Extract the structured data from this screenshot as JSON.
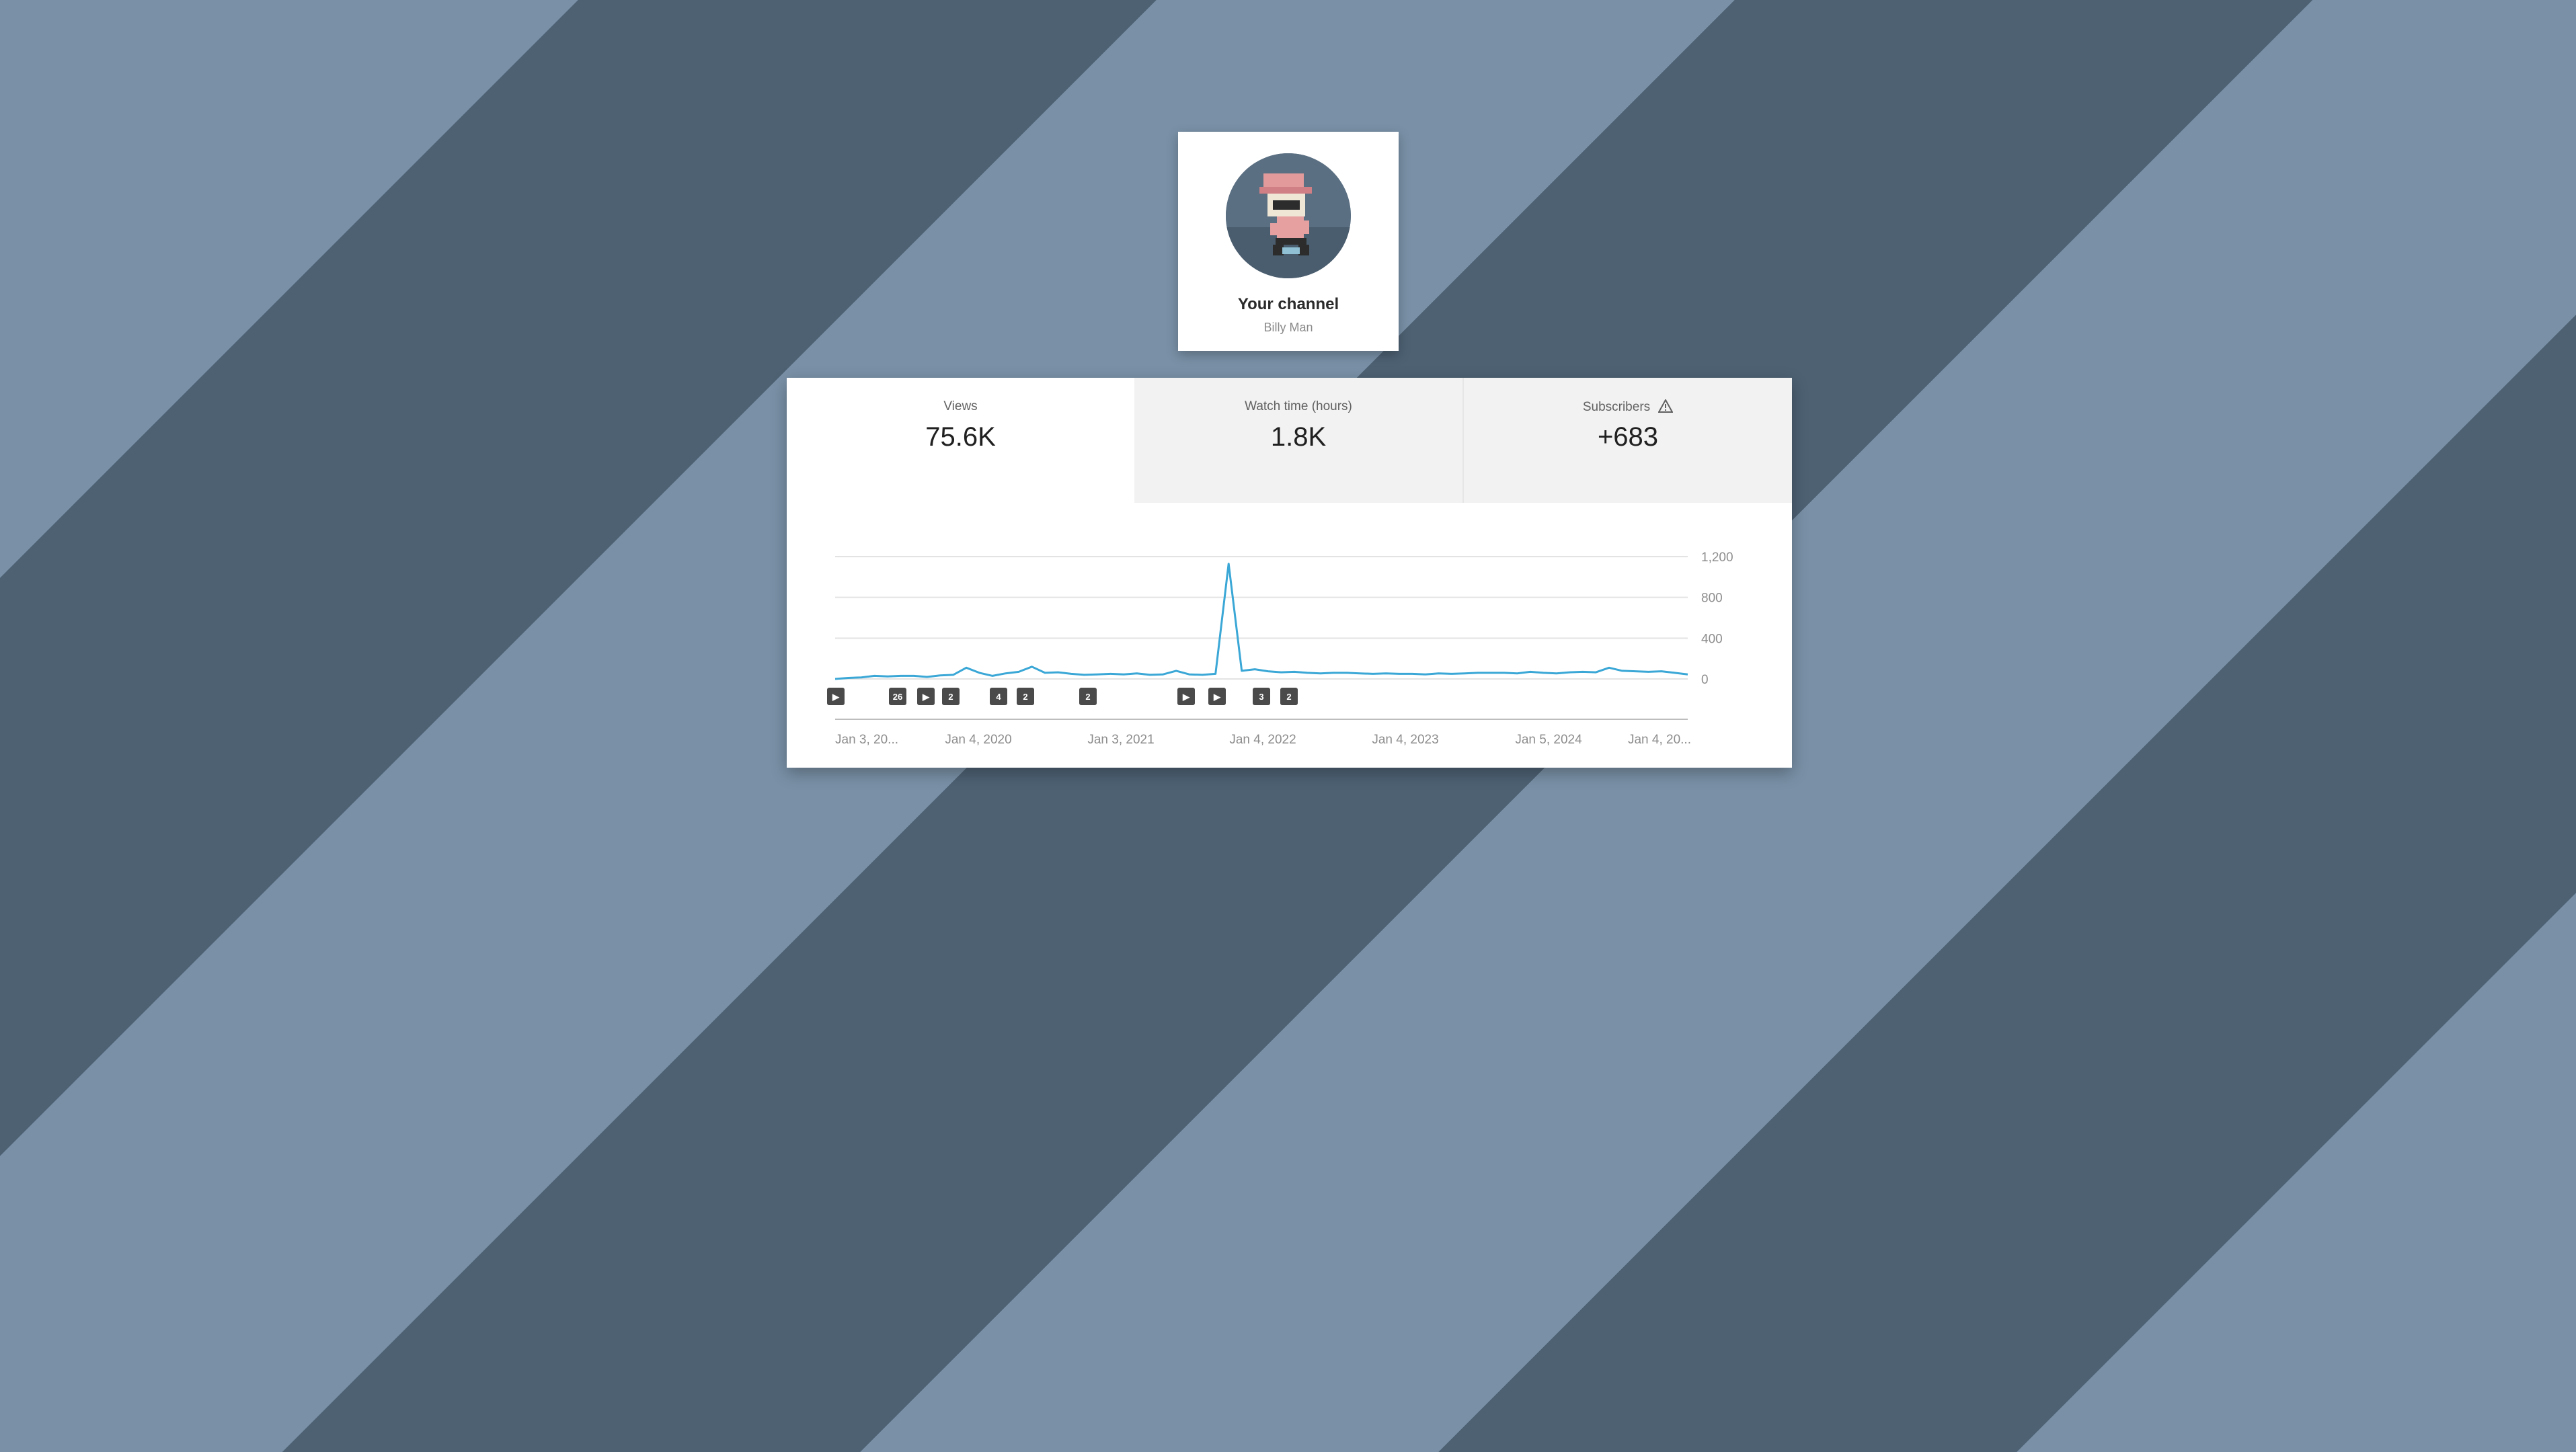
{
  "channel": {
    "title": "Your channel",
    "subtitle": "Billy Man",
    "avatar_icon": "pixel-character-avatar"
  },
  "metrics": [
    {
      "label": "Views",
      "value": "75.6K",
      "selected": true
    },
    {
      "label": "Watch time (hours)",
      "value": "1.8K",
      "selected": false
    },
    {
      "label": "Subscribers",
      "value": "+683",
      "selected": false,
      "icon": "warning-icon"
    }
  ],
  "colors": {
    "line": "#3aa7d6",
    "stripe_light": "#7990a6",
    "stripe_dark": "#4d6173"
  },
  "chart_data": {
    "type": "line",
    "y_ticks": [
      "1,200",
      "800",
      "400",
      "0"
    ],
    "y_values": [
      1200,
      800,
      400,
      0
    ],
    "ylim": [
      0,
      1200
    ],
    "x_tick_labels": [
      "Jan 3, 20...",
      "Jan 4, 2020",
      "Jan 3, 2021",
      "Jan 4, 2022",
      "Jan 4, 2023",
      "Jan 5, 2024",
      "Jan 4, 20..."
    ],
    "grid": true,
    "series": [
      {
        "values": [
          0,
          10,
          15,
          30,
          25,
          30,
          30,
          20,
          35,
          40,
          110,
          60,
          30,
          55,
          70,
          120,
          60,
          65,
          50,
          40,
          45,
          50,
          45,
          55,
          40,
          45,
          80,
          45,
          40,
          50,
          1130,
          80,
          95,
          75,
          65,
          70,
          60,
          55,
          60,
          60,
          55,
          50,
          55,
          50,
          50,
          45,
          55,
          50,
          55,
          60,
          60,
          60,
          55,
          70,
          60,
          55,
          65,
          70,
          65,
          110,
          80,
          75,
          70,
          75,
          60,
          45
        ]
      }
    ],
    "markers": [
      "▶",
      "26",
      "▶",
      "2",
      "4",
      "2",
      "2",
      "▶",
      "▶",
      "3",
      "2"
    ]
  }
}
